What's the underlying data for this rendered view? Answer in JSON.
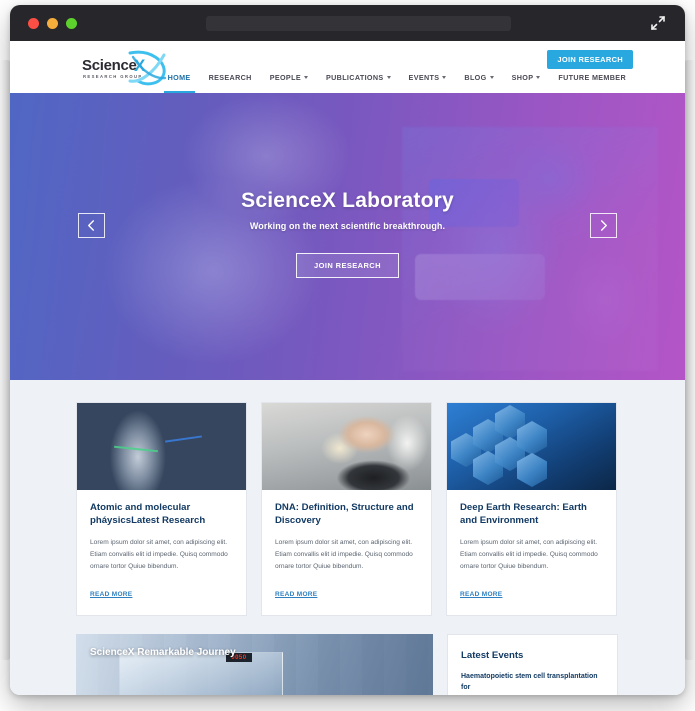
{
  "window": {
    "traffic_lights": [
      "close-red",
      "minimize-yellow",
      "maximize-green"
    ],
    "url_value": "",
    "expand_icon": "expand-diagonal-icon"
  },
  "header": {
    "logo": {
      "word": "Science",
      "x": "X",
      "tagline": "RESEARCH GROUP",
      "mark": "atom-swoosh-icon"
    },
    "cta_label": "JOIN RESEARCH",
    "nav": [
      {
        "label": "HOME",
        "caret": false,
        "active": true
      },
      {
        "label": "RESEARCH",
        "caret": false,
        "active": false
      },
      {
        "label": "PEOPLE",
        "caret": true,
        "active": false
      },
      {
        "label": "PUBLICATIONS",
        "caret": true,
        "active": false
      },
      {
        "label": "EVENTS",
        "caret": true,
        "active": false
      },
      {
        "label": "BLOG",
        "caret": true,
        "active": false
      },
      {
        "label": "SHOP",
        "caret": true,
        "active": false
      },
      {
        "label": "FUTURE MEMBER",
        "caret": false,
        "active": false
      }
    ]
  },
  "hero": {
    "title": "ScienceX Laboratory",
    "subtitle": "Working on the next scientific breakthrough.",
    "cta_label": "JOIN RESEARCH",
    "prev_icon": "chevron-left-icon",
    "next_icon": "chevron-right-icon",
    "image_alt": "scientist looking through a microscope"
  },
  "cards": [
    {
      "title": "Atomic and molecular pháysicsLatest Research",
      "text": "Lorem ipsum dolor sit amet, con adipiscing elit. Etiam convallis elit id impedie. Quisq commodo ornare tortor Quiue bibendum.",
      "link_label": "READ MORE",
      "image_alt": "microscope objective lenses"
    },
    {
      "title": "DNA: Definition, Structure and Discovery",
      "text": "Lorem ipsum dolor sit amet, con adipiscing elit. Etiam convallis elit id impedie. Quisq commodo ornare tortor Quiue bibendum.",
      "link_label": "READ MORE",
      "image_alt": "lab technician handling equipment"
    },
    {
      "title": "Deep Earth Research: Earth and Environment",
      "text": "Lorem ipsum dolor sit amet, con adipiscing elit. Etiam convallis elit id impedie. Quisq commodo ornare tortor Quiue bibendum.",
      "link_label": "READ MORE",
      "image_alt": "hexagonal telescope mirror segments"
    }
  ],
  "bottom": {
    "journey_title": "ScienceX Remarkable Journey",
    "journey_display": "0050",
    "events_title": "Latest Events",
    "events_first_item": "Haematopoietic stem cell transplantation for"
  },
  "colors": {
    "accent_blue": "#29a8e0",
    "heading_navy": "#123a63",
    "section_bg": "#eef1f6",
    "titlebar": "#26262b"
  }
}
